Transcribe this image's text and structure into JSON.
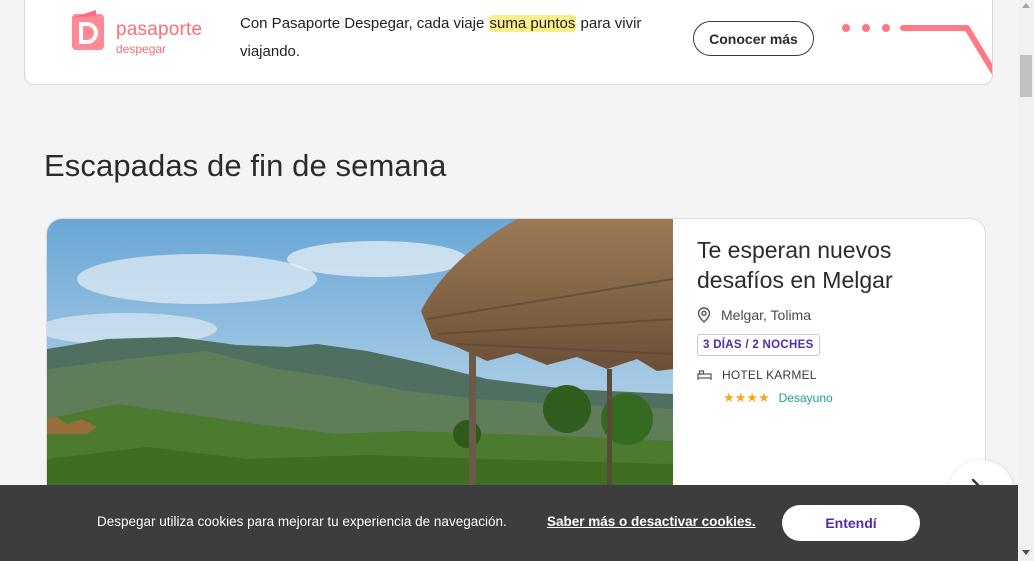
{
  "banner": {
    "logo_name": "pasaporte",
    "logo_sub": "despegar",
    "text_before": "Con Pasaporte Despegar, cada viaje ",
    "text_highlight": "suma puntos",
    "text_after": " para vivir viajando.",
    "cta_label": "Conocer más",
    "brand_color": "#ff6b7a",
    "highlight_color": "#fbef8c"
  },
  "section": {
    "title": "Escapadas de fin de semana"
  },
  "card": {
    "title": "Te esperan nuevos desafíos en Melgar",
    "location": "Melgar, Tolima",
    "duration_badge": "3 DÍAS / 2 NOCHES",
    "hotel_name": "HOTEL KARMEL",
    "stars_display": "★★★★",
    "star_rating": 4,
    "meal_plan": "Desayuno",
    "icons": [
      "location-pin-icon",
      "bed-icon",
      "star-icon",
      "chevron-right-icon"
    ]
  },
  "cookie_bar": {
    "message": "Despegar utiliza cookies para mejorar tu experiencia de navegación.",
    "link_text": "Saber más o desactivar cookies.",
    "accept_label": "Entendí",
    "accent_color": "#4b2fa8"
  }
}
